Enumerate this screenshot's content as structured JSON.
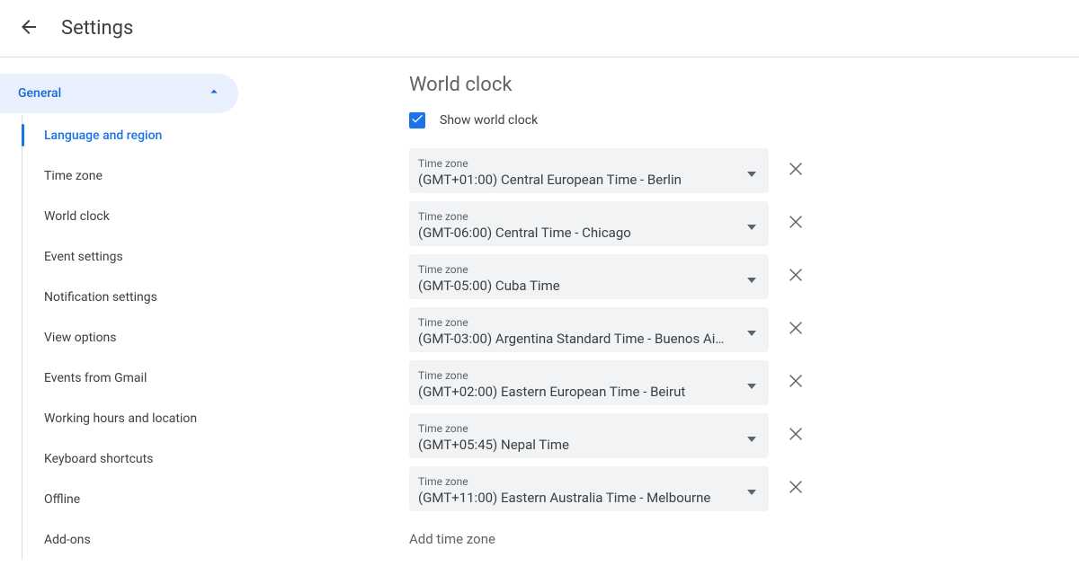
{
  "header": {
    "title": "Settings"
  },
  "sidebar": {
    "section": "General",
    "items": [
      {
        "label": "Language and region",
        "active": true
      },
      {
        "label": "Time zone",
        "active": false
      },
      {
        "label": "World clock",
        "active": false
      },
      {
        "label": "Event settings",
        "active": false
      },
      {
        "label": "Notification settings",
        "active": false
      },
      {
        "label": "View options",
        "active": false
      },
      {
        "label": "Events from Gmail",
        "active": false
      },
      {
        "label": "Working hours and location",
        "active": false
      },
      {
        "label": "Keyboard shortcuts",
        "active": false
      },
      {
        "label": "Offline",
        "active": false
      },
      {
        "label": "Add-ons",
        "active": false
      }
    ]
  },
  "main": {
    "section_title": "World clock",
    "show_checkbox_label": "Show world clock",
    "show_checkbox_checked": true,
    "tz_field_label": "Time zone",
    "timezones": [
      "(GMT+01:00) Central European Time - Berlin",
      "(GMT-06:00) Central Time - Chicago",
      "(GMT-05:00) Cuba Time",
      "(GMT-03:00) Argentina Standard Time - Buenos Ai…",
      "(GMT+02:00) Eastern European Time - Beirut",
      "(GMT+05:45) Nepal Time",
      "(GMT+11:00) Eastern Australia Time - Melbourne"
    ],
    "add_link": "Add time zone"
  }
}
